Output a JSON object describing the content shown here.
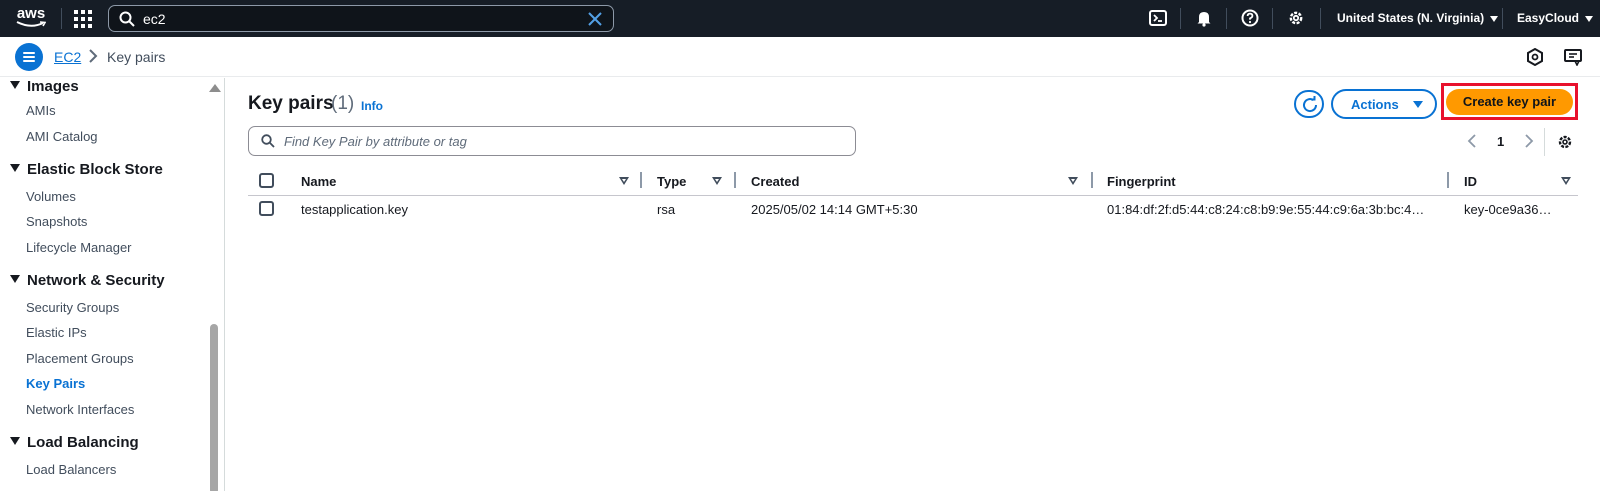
{
  "topbar": {
    "logo_text": "aws",
    "search_value": "ec2",
    "region": "United States (N. Virginia)",
    "account": "EasyCloud",
    "icons": [
      "apps-grid-icon",
      "search-icon",
      "clear-icon",
      "cloudshell-icon",
      "bell-icon",
      "help-icon",
      "settings-gear-icon"
    ]
  },
  "breadcrumb": {
    "root": "EC2",
    "current": "Key pairs"
  },
  "sidebar": {
    "sections": [
      {
        "title": "Images",
        "items": [
          "AMIs",
          "AMI Catalog"
        ]
      },
      {
        "title": "Elastic Block Store",
        "items": [
          "Volumes",
          "Snapshots",
          "Lifecycle Manager"
        ]
      },
      {
        "title": "Network & Security",
        "items": [
          "Security Groups",
          "Elastic IPs",
          "Placement Groups",
          "Key Pairs",
          "Network Interfaces"
        ]
      },
      {
        "title": "Load Balancing",
        "items": [
          "Load Balancers"
        ]
      }
    ],
    "active_item": "Key Pairs"
  },
  "main": {
    "title": "Key pairs",
    "count": "(1)",
    "info": "Info",
    "actions_label": "Actions",
    "create_label": "Create key pair",
    "filter_placeholder": "Find Key Pair by attribute or tag",
    "page_number": "1"
  },
  "table": {
    "columns": [
      "Name",
      "Type",
      "Created",
      "Fingerprint",
      "ID"
    ],
    "rows": [
      {
        "name": "testapplication.key",
        "type": "rsa",
        "created": "2025/05/02 14:14 GMT+5:30",
        "fingerprint": "01:84:df:2f:d5:44:c8:24:c8:b9:9e:55:44:c9:6a:3b:bc:4…",
        "id": "key-0ce9a36…"
      }
    ]
  },
  "colors": {
    "topbar_bg": "#161d26",
    "link_blue": "#0972d3",
    "primary_orange": "#ff9900",
    "highlight_red": "#e8112d"
  }
}
